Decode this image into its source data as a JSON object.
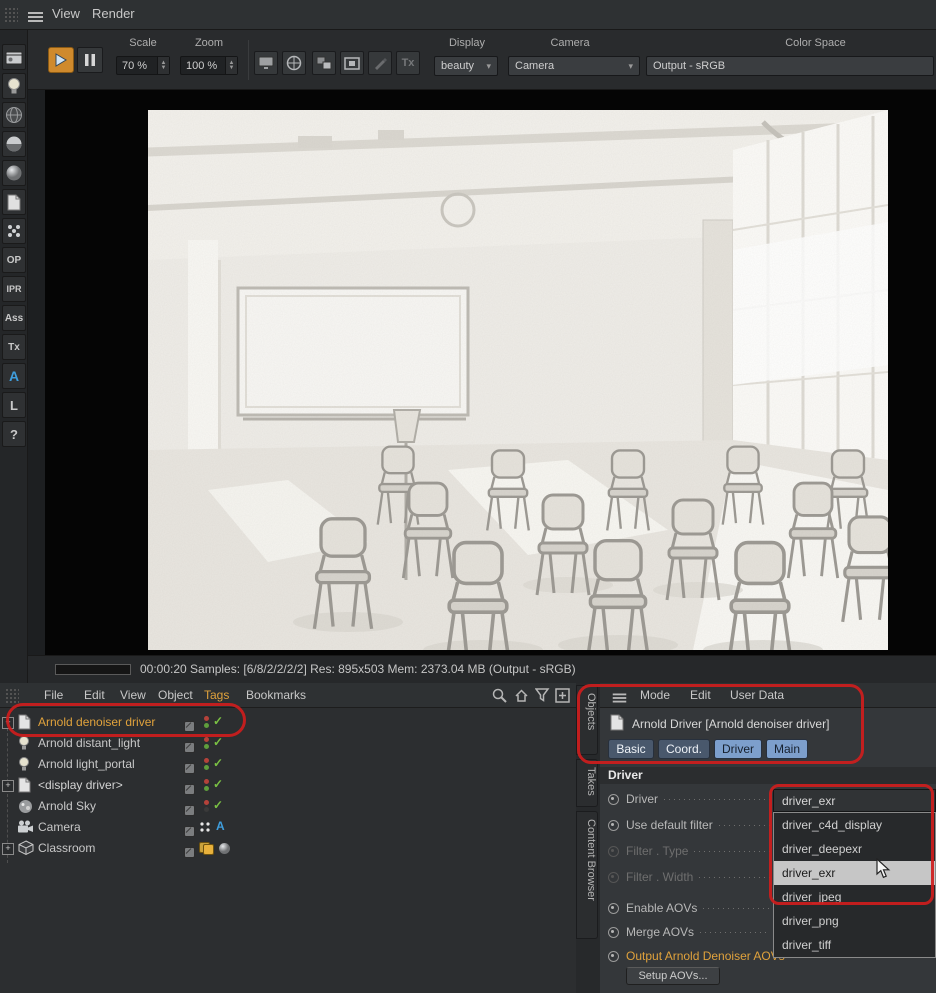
{
  "menubar": {
    "items": [
      "View",
      "Render"
    ]
  },
  "toolbar": {
    "scale_label": "Scale",
    "scale_value": "70 %",
    "zoom_label": "Zoom",
    "zoom_value": "100 %",
    "tx_button": "Tx",
    "display_label": "Display",
    "display_value": "beauty",
    "camera_label": "Camera",
    "camera_value": "Camera",
    "colorspace_label": "Color Space",
    "colorspace_value": "Output - sRGB"
  },
  "left_toolbar": {
    "labels": [
      "OP",
      "IPR",
      "Ass",
      "Tx",
      "A",
      "L",
      "?"
    ]
  },
  "status": {
    "text": "00:00:20 Samples: [6/8/2/2/2/2] Res: 895x503 Mem: 2373.04 MB (Output - sRGB)"
  },
  "object_manager": {
    "menu": [
      "File",
      "Edit",
      "View",
      "Object",
      "Tags",
      "Bookmarks"
    ],
    "objects": [
      {
        "label": "Arnold denoiser driver"
      },
      {
        "label": "Arnold distant_light"
      },
      {
        "label": "Arnold light_portal"
      },
      {
        "label": "<display driver>"
      },
      {
        "label": "Arnold Sky"
      },
      {
        "label": "Camera"
      },
      {
        "label": "Classroom"
      }
    ]
  },
  "side_tabs": {
    "items": [
      "Objects",
      "Takes",
      "Content Browser"
    ]
  },
  "attribute_manager": {
    "menu": [
      "Mode",
      "Edit",
      "User Data"
    ],
    "title": "Arnold Driver [Arnold denoiser driver]",
    "tabs": [
      "Basic",
      "Coord.",
      "Driver",
      "Main"
    ],
    "section": "Driver",
    "rows": [
      {
        "label": "Driver"
      },
      {
        "label": "Use default filter"
      },
      {
        "label": "Filter . Type"
      },
      {
        "label": "Filter . Width"
      },
      {
        "label": "Enable AOVs"
      },
      {
        "label": "Merge AOVs"
      },
      {
        "label": "Output Arnold Denoiser AOVs"
      }
    ],
    "setup_button": "Setup AOVs...",
    "dropdown": {
      "value": "driver_exr",
      "options": [
        "driver_c4d_display",
        "driver_deepexr",
        "driver_exr",
        "driver_jpeg",
        "driver_png",
        "driver_tiff"
      ],
      "hovered_option": "driver_exr"
    }
  },
  "icons": {
    "menu": "hamburger",
    "search": "magnifier",
    "filter": "funnel",
    "add": "plus-box",
    "home": "up-level",
    "check": "checkmark",
    "chevron": "chevron-down"
  },
  "colors": {
    "accent_orange": "#e0a23c",
    "annotation_red": "#ce1d1d",
    "tab_active_blue": "#7d9fcc",
    "tab_inactive_blue": "#49586c",
    "check_green": "#7ac143",
    "arnold_blue": "#3f9edd"
  }
}
